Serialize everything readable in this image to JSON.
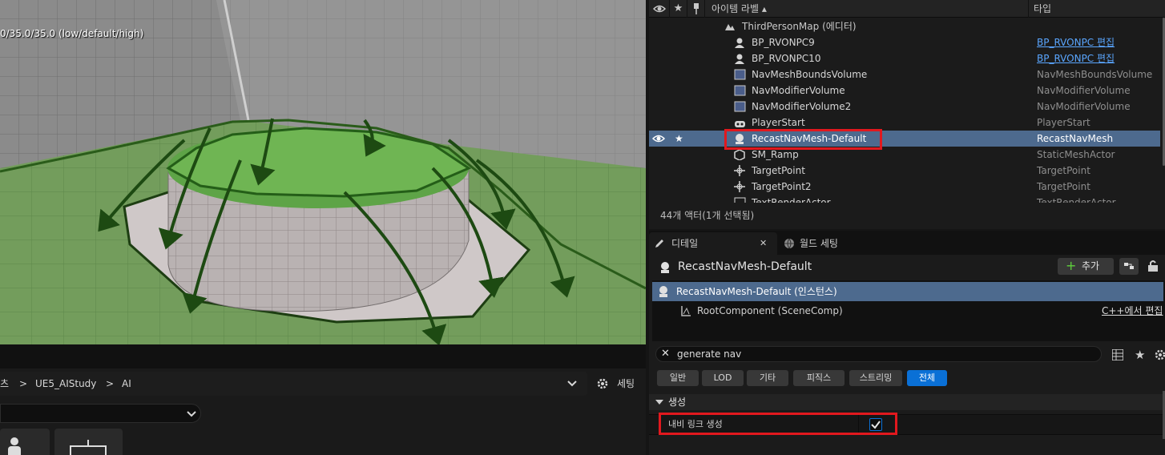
{
  "viewport": {
    "stat_text": "0/35.0/35.0 (low/default/high)"
  },
  "content_browser": {
    "breadcrumbs": [
      "츠",
      "UE5_AIStudy",
      "AI"
    ],
    "separator": ">",
    "settings_label": "세팅"
  },
  "outliner": {
    "columns": {
      "label": "아이템 라벨 ▴",
      "type": "타입"
    },
    "map_name": "ThirdPersonMap (에디터)",
    "rows": [
      {
        "label": "BP_RVONPC9",
        "type": "BP_RVONPC 편집",
        "icon": "character-icon"
      },
      {
        "label": "BP_RVONPC10",
        "type": "BP_RVONPC 편집",
        "icon": "character-icon"
      },
      {
        "label": "NavMeshBoundsVolume",
        "type": "NavMeshBoundsVolume",
        "icon": "volume-icon"
      },
      {
        "label": "NavModifierVolume",
        "type": "NavModifierVolume",
        "icon": "volume-icon"
      },
      {
        "label": "NavModifierVolume2",
        "type": "NavModifierVolume",
        "icon": "volume-icon"
      },
      {
        "label": "PlayerStart",
        "type": "PlayerStart",
        "icon": "player-start-icon"
      },
      {
        "label": "RecastNavMesh-Default",
        "type": "RecastNavMesh",
        "icon": "actor-icon"
      },
      {
        "label": "SM_Ramp",
        "type": "StaticMeshActor",
        "icon": "static-mesh-icon"
      },
      {
        "label": "TargetPoint",
        "type": "TargetPoint",
        "icon": "target-point-icon"
      },
      {
        "label": "TargetPoint2",
        "type": "TargetPoint",
        "icon": "target-point-icon"
      },
      {
        "label": "TextRenderActor",
        "type": "TextRenderActor",
        "icon": "text-render-icon"
      }
    ],
    "selected_star": "★",
    "status": "44개 액터(1개 선택됨)"
  },
  "details": {
    "tab_details": "디테일",
    "tab_world": "월드 세팅",
    "tab_close": "✕",
    "title": "RecastNavMesh-Default",
    "add_button": "추가",
    "component_instance": "RecastNavMesh-Default (인스턴스)",
    "root_component": "RootComponent (SceneComp)",
    "edit_in_cpp": "C++에서 편집",
    "search_value": "generate nav",
    "filters": [
      "일반",
      "LOD",
      "기타",
      "피직스",
      "스트리밍",
      "전체"
    ],
    "active_filter": "전체",
    "category": "생성",
    "property_label": "내비 링크 생성",
    "property_checked": true
  },
  "colors": {
    "selection": "#4d6a8e",
    "accent_blue": "#0a70d6",
    "highlight_red": "#e1181e",
    "navmesh_green": "#5ea447"
  }
}
